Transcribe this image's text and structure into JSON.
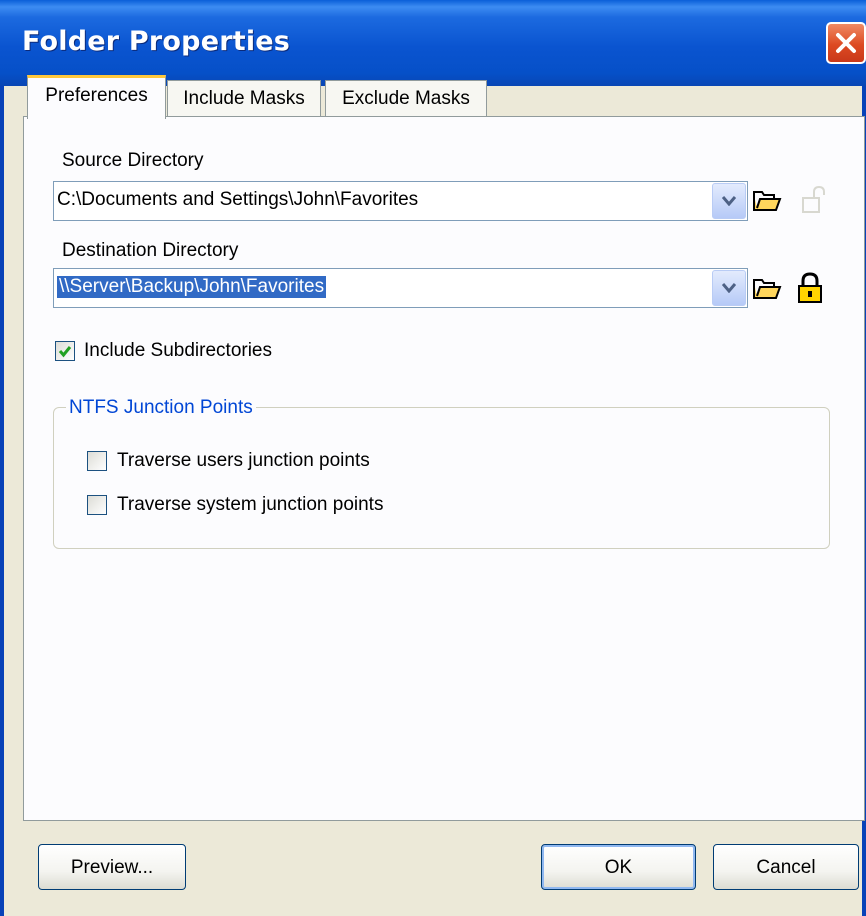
{
  "window": {
    "title": "Folder Properties"
  },
  "tabs": [
    "Preferences",
    "Include Masks",
    "Exclude Masks"
  ],
  "source": {
    "label": "Source Directory",
    "value": "C:\\Documents and Settings\\John\\Favorites"
  },
  "destination": {
    "label": "Destination Directory",
    "value": "\\\\Server\\Backup\\John\\Favorites"
  },
  "include_subdirs": {
    "label": "Include Subdirectories",
    "checked": true
  },
  "ntfs": {
    "title": "NTFS Junction Points",
    "users_label": "Traverse users junction points",
    "system_label": "Traverse system junction points"
  },
  "buttons": {
    "preview": "Preview...",
    "ok": "OK",
    "cancel": "Cancel"
  },
  "colors": {
    "titlebar": "#0a54d0",
    "selection": "#316ac5",
    "groupbox_title": "#0046d5",
    "tab_highlight": "#ffc83c"
  }
}
